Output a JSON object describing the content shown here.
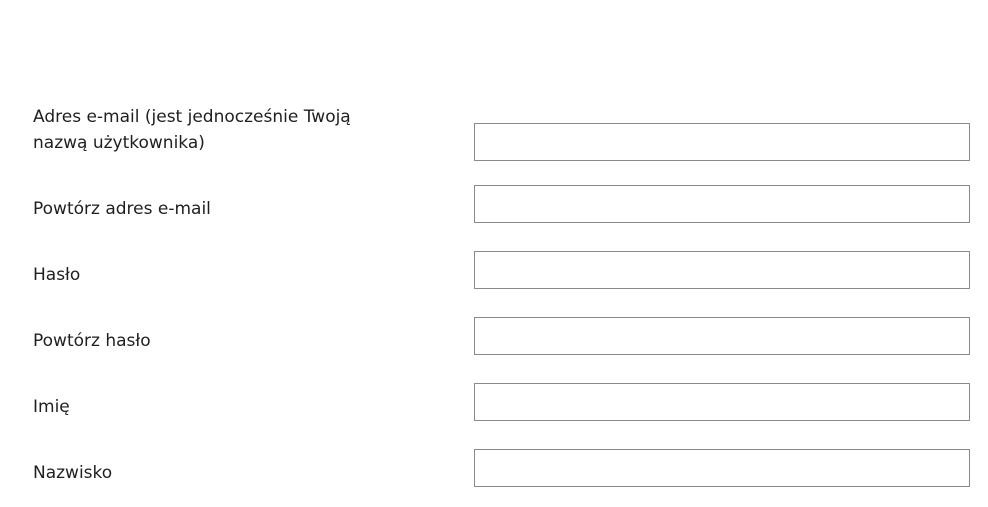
{
  "form": {
    "fields": [
      {
        "label": "Adres e-mail (jest jednocześnie Twoją",
        "label_line2": "nazwą użytkownika)",
        "value": ""
      },
      {
        "label": "Powtórz adres e-mail",
        "value": ""
      },
      {
        "label": "Hasło",
        "value": ""
      },
      {
        "label": "Powtórz hasło",
        "value": ""
      },
      {
        "label": "Imię",
        "value": ""
      },
      {
        "label": "Nazwisko",
        "value": ""
      }
    ]
  }
}
